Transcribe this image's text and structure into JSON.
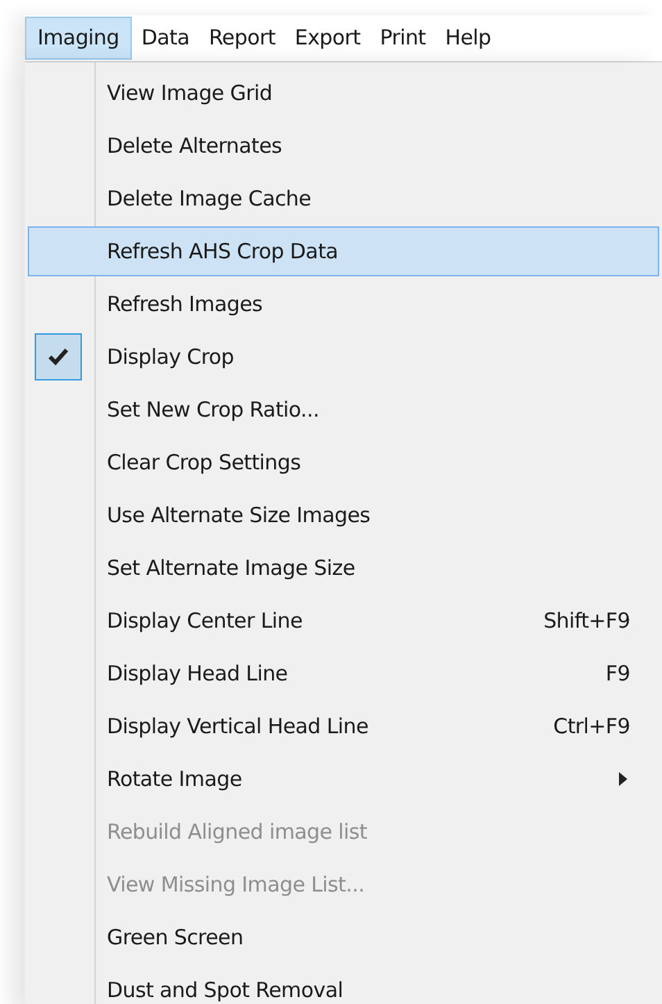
{
  "menu_bar": [
    {
      "label": "Imaging",
      "selected": true
    },
    {
      "label": "Data",
      "selected": false
    },
    {
      "label": "Report",
      "selected": false
    },
    {
      "label": "Export",
      "selected": false
    },
    {
      "label": "Print",
      "selected": false
    },
    {
      "label": "Help",
      "selected": false
    }
  ],
  "menu_items": [
    {
      "label": "View Image Grid",
      "selected": false,
      "checked": false,
      "disabled": false
    },
    {
      "label": "Delete Alternates",
      "selected": false,
      "checked": false,
      "disabled": false
    },
    {
      "label": "Delete Image Cache",
      "selected": false,
      "checked": false,
      "disabled": false
    },
    {
      "label": "Refresh AHS Crop Data",
      "selected": true,
      "checked": false,
      "disabled": false
    },
    {
      "label": "Refresh Images",
      "selected": false,
      "checked": false,
      "disabled": false
    },
    {
      "label": "Display Crop",
      "selected": false,
      "checked": true,
      "disabled": false
    },
    {
      "label": "Set New Crop Ratio...",
      "selected": false,
      "checked": false,
      "disabled": false
    },
    {
      "label": "Clear Crop Settings",
      "selected": false,
      "checked": false,
      "disabled": false
    },
    {
      "label": "Use Alternate Size Images",
      "selected": false,
      "checked": false,
      "disabled": false
    },
    {
      "label": "Set Alternate Image Size",
      "selected": false,
      "checked": false,
      "disabled": false
    },
    {
      "label": "Display Center Line",
      "shortcut": "Shift+F9",
      "selected": false,
      "checked": false,
      "disabled": false
    },
    {
      "label": "Display Head Line",
      "shortcut": "F9",
      "selected": false,
      "checked": false,
      "disabled": false
    },
    {
      "label": "Display Vertical Head Line",
      "shortcut": "Ctrl+F9",
      "selected": false,
      "checked": false,
      "disabled": false
    },
    {
      "label": "Rotate Image",
      "submenu": true,
      "selected": false,
      "checked": false,
      "disabled": false
    },
    {
      "label": "Rebuild Aligned image list",
      "selected": false,
      "checked": false,
      "disabled": true
    },
    {
      "label": "View Missing Image List...",
      "selected": false,
      "checked": false,
      "disabled": true
    },
    {
      "label": "Green Screen",
      "selected": false,
      "checked": false,
      "disabled": false
    },
    {
      "label": "Dust and Spot Removal",
      "selected": false,
      "checked": false,
      "disabled": false
    }
  ]
}
